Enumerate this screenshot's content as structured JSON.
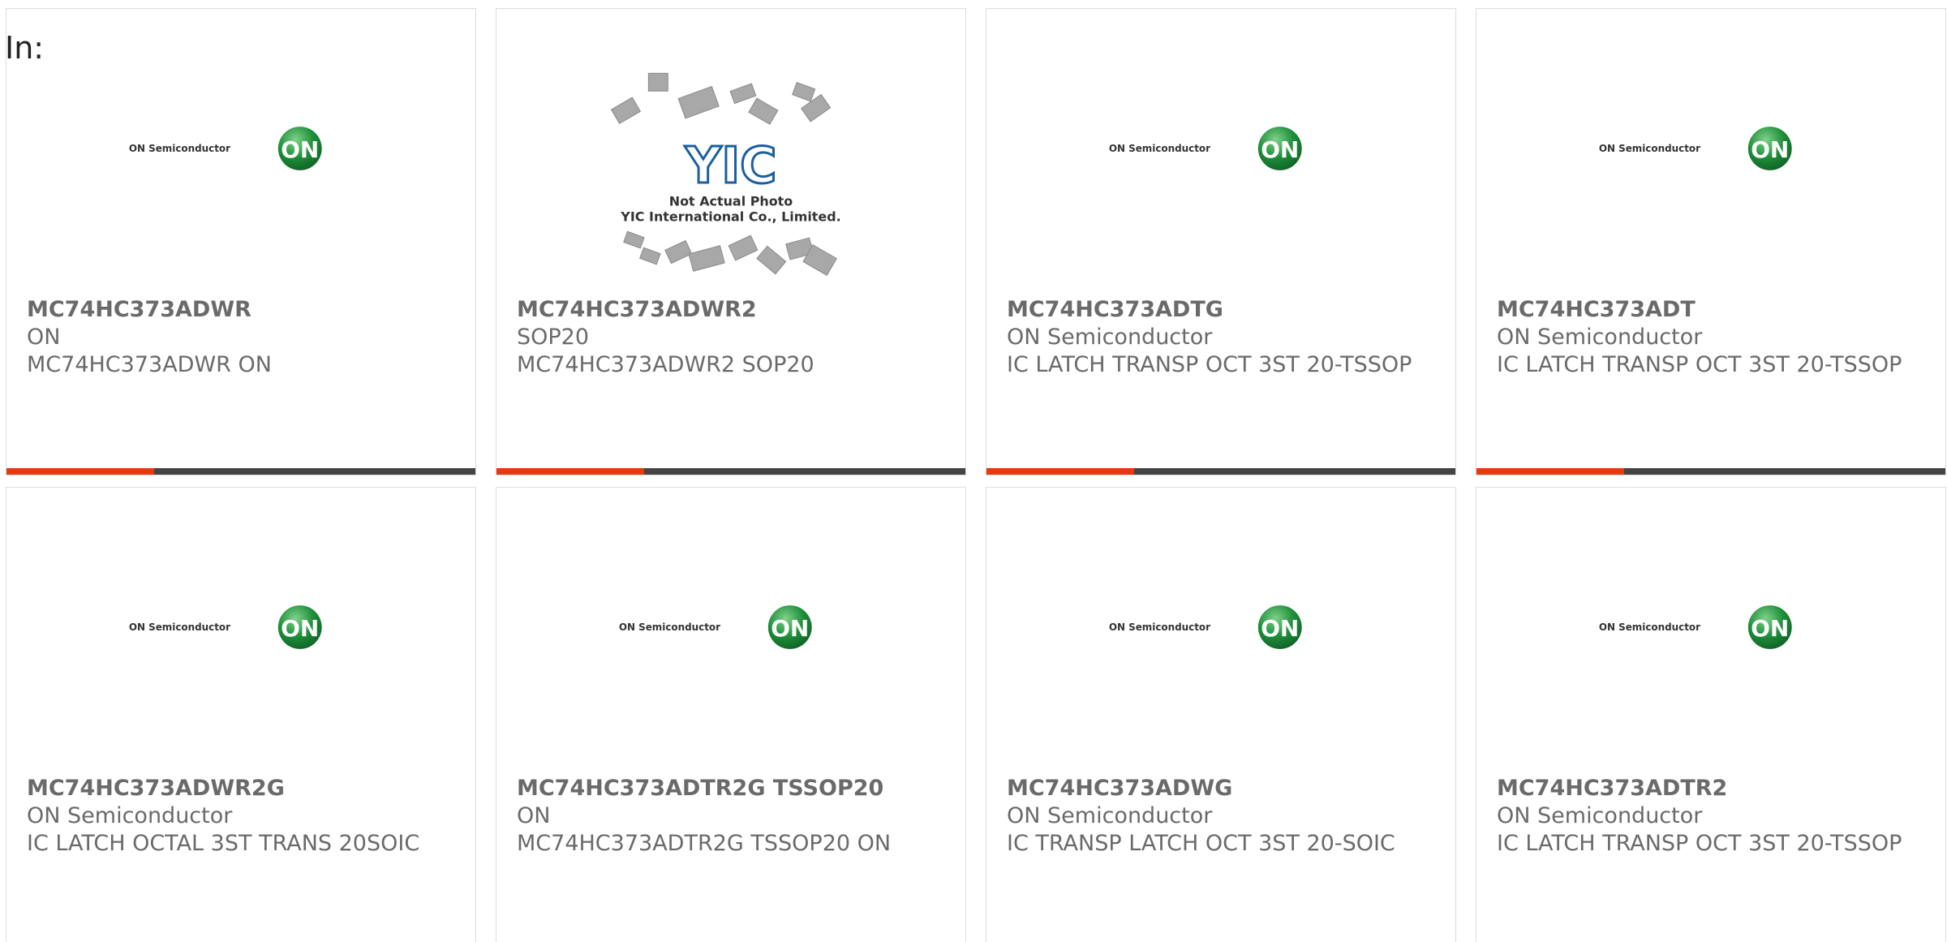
{
  "header": {
    "label": "In:"
  },
  "brand": {
    "on_text": "ON Semiconductor",
    "on_mark": "ON",
    "yic_mark": "YIC",
    "yic_line1": "Not Actual Photo",
    "yic_line2": "YIC International Co., Limited.",
    "accent_color": "#e8380d",
    "bar_color": "#444444",
    "logo_green": "#1f8f3a"
  },
  "products": [
    {
      "name": "MC74HC373ADWR",
      "maker": "ON",
      "desc": "MC74HC373ADWR ON",
      "image": "on-semiconductor-logo"
    },
    {
      "name": "MC74HC373ADWR2",
      "maker": "SOP20",
      "desc": "MC74HC373ADWR2 SOP20",
      "image": "yic-not-actual-photo"
    },
    {
      "name": "MC74HC373ADTG",
      "maker": "ON Semiconductor",
      "desc": "IC LATCH TRANSP OCT 3ST 20-TSSOP",
      "image": "on-semiconductor-logo"
    },
    {
      "name": "MC74HC373ADT",
      "maker": "ON Semiconductor",
      "desc": "IC LATCH TRANSP OCT 3ST 20-TSSOP",
      "image": "on-semiconductor-logo"
    },
    {
      "name": "MC74HC373ADWR2G",
      "maker": "ON Semiconductor",
      "desc": "IC LATCH OCTAL 3ST TRANS 20SOIC",
      "image": "on-semiconductor-logo"
    },
    {
      "name": "MC74HC373ADTR2G TSSOP20",
      "maker": "ON",
      "desc": "MC74HC373ADTR2G TSSOP20 ON",
      "image": "on-semiconductor-logo"
    },
    {
      "name": "MC74HC373ADWG",
      "maker": "ON Semiconductor",
      "desc": "IC TRANSP LATCH OCT 3ST 20-SOIC",
      "image": "on-semiconductor-logo"
    },
    {
      "name": "MC74HC373ADTR2",
      "maker": "ON Semiconductor",
      "desc": "IC LATCH TRANSP OCT 3ST 20-TSSOP",
      "image": "on-semiconductor-logo"
    }
  ]
}
